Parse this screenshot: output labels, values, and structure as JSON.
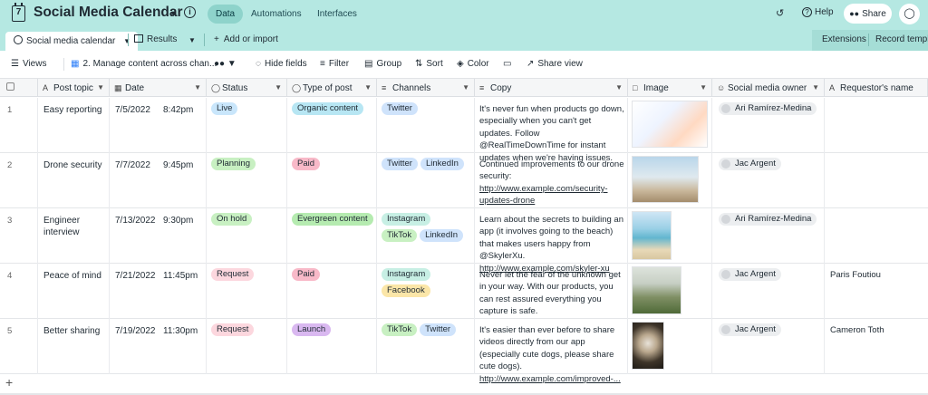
{
  "header": {
    "app_icon": "calendar-icon",
    "title": "Social Media Calendar",
    "nav": [
      "Data",
      "Automations",
      "Interfaces"
    ],
    "help_label": "Help",
    "share_label": "Share"
  },
  "tabs": {
    "active": "Social media calendar",
    "results": "Results",
    "add": "Add or import",
    "extensions": "Extensions",
    "record_templates": "Record templa"
  },
  "toolbar": {
    "views": "Views",
    "view_name": "2. Manage content across chan...",
    "hide_fields": "Hide fields",
    "filter": "Filter",
    "group": "Group",
    "sort": "Sort",
    "color": "Color",
    "share_view": "Share view"
  },
  "columns": [
    "Post topic",
    "Date",
    "Status",
    "Type of post",
    "Channels",
    "Copy",
    "Image",
    "Social media owner",
    "Requestor's name"
  ],
  "colors": {
    "accent": "#b5e8e2",
    "status_live": "#c9e6fb",
    "status_planning": "#c8f0c2",
    "status_on_hold": "#c8f0c2",
    "status_request": "#fcd7de",
    "type_organic": "#b7e6f3",
    "type_paid": "#f8b9c8",
    "type_evergreen": "#b5ebb0",
    "type_launch": "#d9b8f0",
    "ch_twitter": "#cfe3fb",
    "ch_linkedin": "#cfe3fb",
    "ch_instagram": "#c7efe4",
    "ch_tiktok": "#c8f0c2",
    "ch_facebook": "#fbe6a8"
  },
  "rows": [
    {
      "num": "1",
      "topic": "Easy reporting",
      "date": "7/5/2022",
      "time": "8:42pm",
      "status": "Live",
      "type": "Organic content",
      "channels": [
        "Twitter"
      ],
      "copy_text": "It's never fun when products go down, especially when you can't get updates. Follow @RealTimeDownTime for instant updates when we're having issues.",
      "copy_link": "",
      "owner": "Ari Ramírez-Medina",
      "requestor": ""
    },
    {
      "num": "2",
      "topic": "Drone security",
      "date": "7/7/2022",
      "time": "9:45pm",
      "status": "Planning",
      "type": "Paid",
      "channels": [
        "Twitter",
        "LinkedIn"
      ],
      "copy_text": "Continued improvements to our drone security:",
      "copy_link": "http://www.example.com/security-updates-drone",
      "owner": "Jac Argent",
      "requestor": ""
    },
    {
      "num": "3",
      "topic": "Engineer interview",
      "date": "7/13/2022",
      "time": "9:30pm",
      "status": "On hold",
      "type": "Evergreen content",
      "channels": [
        "Instagram",
        "TikTok",
        "LinkedIn"
      ],
      "copy_text": "Learn about the secrets to building an app (it involves going to the beach) that makes users happy from @SkylerXu.",
      "copy_link": "http://www.example.com/skyler-xu",
      "owner": "Ari Ramírez-Medina",
      "requestor": ""
    },
    {
      "num": "4",
      "topic": "Peace of mind",
      "date": "7/21/2022",
      "time": "11:45pm",
      "status": "Request",
      "type": "Paid",
      "channels": [
        "Instagram",
        "Facebook"
      ],
      "copy_text": "Never let the fear of the unknown get in your way. With our products, you can rest assured everything you capture is safe.",
      "copy_link": "",
      "owner": "Jac Argent",
      "requestor": "Paris Foutiou"
    },
    {
      "num": "5",
      "topic": "Better sharing",
      "date": "7/19/2022",
      "time": "11:30pm",
      "status": "Request",
      "type": "Launch",
      "channels": [
        "TikTok",
        "Twitter"
      ],
      "copy_text": "It's easier than ever before to share videos directly from our app (especially cute dogs, please share cute dogs).",
      "copy_link": "http://www.example.com/improved-...",
      "owner": "Jac Argent",
      "requestor": "Cameron Toth"
    }
  ]
}
